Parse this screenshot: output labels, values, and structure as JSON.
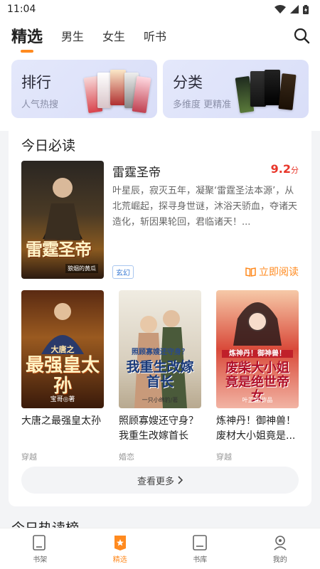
{
  "status": {
    "time": "11:04"
  },
  "top_tabs": [
    {
      "label": "精选",
      "active": true
    },
    {
      "label": "男生",
      "active": false
    },
    {
      "label": "女生",
      "active": false
    },
    {
      "label": "听书",
      "active": false
    }
  ],
  "categories": [
    {
      "title": "排行",
      "subtitle": "人气热搜"
    },
    {
      "title": "分类",
      "subtitle": "多维度 更精准"
    }
  ],
  "must_read": {
    "section_title": "今日必读",
    "featured": {
      "title": "雷霆圣帝",
      "cover_text": "雷霆圣帝",
      "cover_author": "狼烟的黄瓜",
      "score": "9.2",
      "score_unit": "分",
      "description": "叶星辰，寂灭五年，凝聚‘雷霆圣法本源’，从北荒崛起，探寻身世谜，沐浴天骄血，夺诸天造化，斩因果轮回，君临诸天！...",
      "tag": "玄幻",
      "read_label": "立即阅读"
    },
    "books": [
      {
        "title": "大唐之最强皇太孙",
        "genre": "穿越",
        "cover_text": "最强皇太孙",
        "cover_sub": "大唐之",
        "cover_author": "宝哥◎著"
      },
      {
        "title": "照顾寡嫂还守身？我重生改嫁首长",
        "genre": "婚恋",
        "cover_text": "我重生改嫁首长",
        "cover_sub": "照顾寡嫂还守身？",
        "cover_author": "一只小绵豹/著"
      },
      {
        "title": "炼神丹！御神兽！废材大小姐竟是...",
        "genre": "穿越",
        "cover_text": "废柴大小姐竟是绝世帝女",
        "cover_sub": "炼神丹！御神兽！",
        "cover_author": "叶芷宜/作品"
      }
    ],
    "more_label": "查看更多"
  },
  "next_section_title": "今日热读榜",
  "bottom_nav": [
    {
      "label": "书架",
      "icon": "bookshelf-icon",
      "active": false
    },
    {
      "label": "精选",
      "icon": "featured-icon",
      "active": true
    },
    {
      "label": "书库",
      "icon": "library-icon",
      "active": false
    },
    {
      "label": "我的",
      "icon": "profile-icon",
      "active": false
    }
  ],
  "colors": {
    "accent": "#ff8a1f",
    "score": "#e8362a",
    "tag": "#3a7bd5",
    "card_bg": "#dde2f8"
  }
}
